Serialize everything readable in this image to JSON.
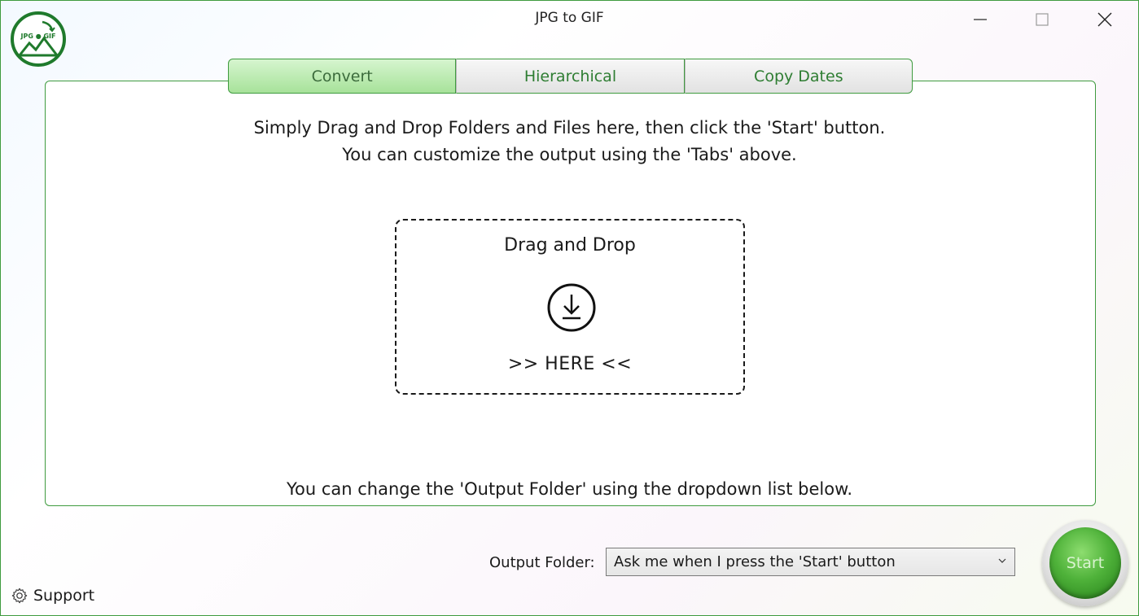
{
  "window": {
    "title": "JPG to GIF",
    "logo_text": "JPG ● GIF"
  },
  "tabs": [
    {
      "label": "Convert",
      "active": true
    },
    {
      "label": "Hierarchical",
      "active": false
    },
    {
      "label": "Copy Dates",
      "active": false
    }
  ],
  "main": {
    "instruction_line1": "Simply Drag and Drop Folders and Files here, then click the 'Start' button.",
    "instruction_line2": "You can customize the output using the 'Tabs' above.",
    "dropzone_title": "Drag and Drop",
    "dropzone_icon": "download-circle-icon",
    "dropzone_here": ">> HERE <<",
    "output_note": "You can change the 'Output Folder' using the dropdown list below."
  },
  "output": {
    "label": "Output Folder:",
    "selected": "Ask me when I press the 'Start' button"
  },
  "start_button": "Start",
  "support": "Support",
  "colors": {
    "accent": "#3f9b3f",
    "tab_text": "#2e7d32",
    "start_green": "#4fb23a"
  }
}
